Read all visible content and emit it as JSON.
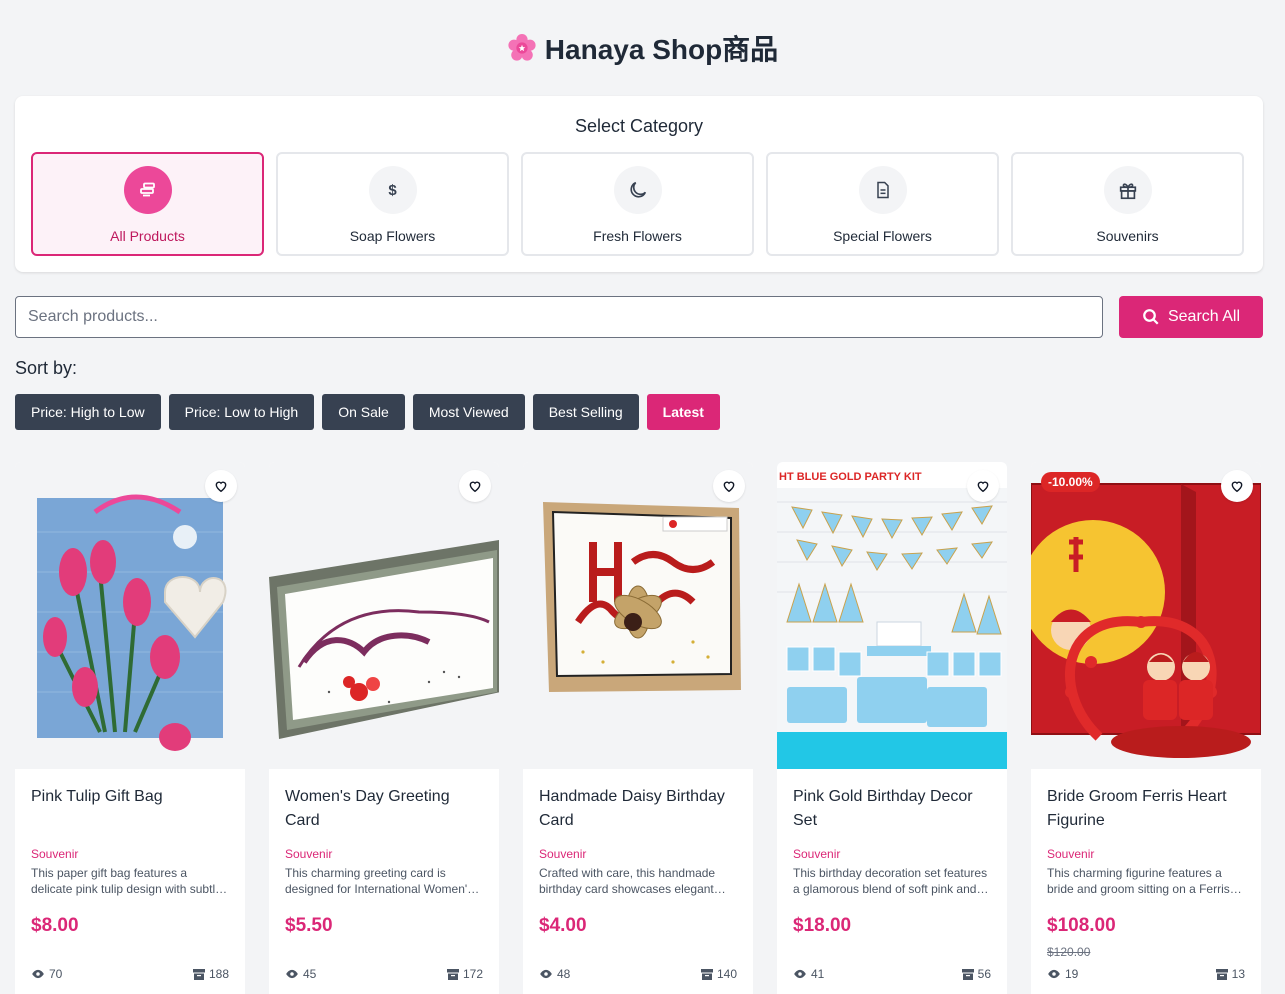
{
  "page": {
    "title": "Hanaya Shop商品",
    "title_icon": "sakura-flower-icon"
  },
  "category": {
    "heading": "Select Category",
    "items": [
      {
        "label": "All Products",
        "icon": "list-icon",
        "active": true
      },
      {
        "label": "Soap Flowers",
        "icon": "dollar-icon",
        "active": false
      },
      {
        "label": "Fresh Flowers",
        "icon": "moon-icon",
        "active": false
      },
      {
        "label": "Special Flowers",
        "icon": "document-icon",
        "active": false
      },
      {
        "label": "Souvenirs",
        "icon": "gift-icon",
        "active": false
      }
    ]
  },
  "search": {
    "placeholder": "Search products...",
    "value": "",
    "button_label": "Search All",
    "button_icon": "search-icon"
  },
  "sort": {
    "label": "Sort by:",
    "options": [
      {
        "label": "Price: High to Low",
        "active": false
      },
      {
        "label": "Price: Low to High",
        "active": false
      },
      {
        "label": "On Sale",
        "active": false
      },
      {
        "label": "Most Viewed",
        "active": false
      },
      {
        "label": "Best Selling",
        "active": false
      },
      {
        "label": "Latest",
        "active": true
      }
    ]
  },
  "products": [
    {
      "name": "Pink Tulip Gift Bag",
      "category": "Souvenir",
      "description": "This paper gift bag features a delicate pink tulip design with subtle accents.",
      "price": "$8.00",
      "old_price": "",
      "discount": "",
      "views": "70",
      "sold": "188",
      "image_caption": ""
    },
    {
      "name": "Women's Day Greeting Card",
      "category": "Souvenir",
      "description": "This charming greeting card is designed for International Women's Day.",
      "price": "$5.50",
      "old_price": "",
      "discount": "",
      "views": "45",
      "sold": "172",
      "image_caption": ""
    },
    {
      "name": "Handmade Daisy Birthday Card",
      "category": "Souvenir",
      "description": "Crafted with care, this handmade birthday card showcases elegant detail.",
      "price": "$4.00",
      "old_price": "",
      "discount": "",
      "views": "48",
      "sold": "140",
      "image_caption": ""
    },
    {
      "name": "Pink Gold Birthday Decor Set",
      "category": "Souvenir",
      "description": "This birthday decoration set features a glamorous blend of soft pink and gold.",
      "price": "$18.00",
      "old_price": "",
      "discount": "",
      "views": "41",
      "sold": "56",
      "image_caption": "HT BLUE GOLD PARTY KIT"
    },
    {
      "name": "Bride Groom Ferris Heart Figurine",
      "category": "Souvenir",
      "description": "This charming figurine features a bride and groom sitting on a Ferris wheel.",
      "price": "$108.00",
      "old_price": "$120.00",
      "discount": "-10.00%",
      "views": "19",
      "sold": "13",
      "image_caption": ""
    }
  ],
  "colors": {
    "accent": "#db2777",
    "dark_button": "#374151",
    "badge": "#dc2626",
    "background": "#f3f4f6"
  }
}
